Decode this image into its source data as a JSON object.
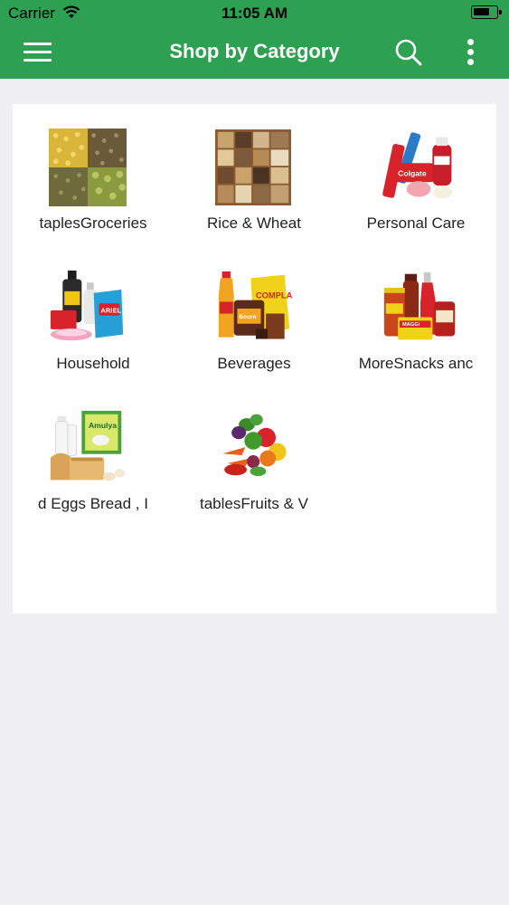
{
  "status_bar": {
    "carrier": "Carrier",
    "time": "11:05 AM"
  },
  "nav_bar": {
    "title": "Shop by Category",
    "menu_icon": "hamburger-menu-icon",
    "search_icon": "search-icon",
    "more_icon": "more-vertical-icon",
    "color": "#2ea052"
  },
  "categories": [
    {
      "label": "taplesGroceries",
      "icon": "grains-icon"
    },
    {
      "label": "Rice & Wheat",
      "icon": "spice-box-icon"
    },
    {
      "label": "Personal Care",
      "icon": "toiletries-icon"
    },
    {
      "label": "Household",
      "icon": "cleaning-products-icon"
    },
    {
      "label": "Beverages",
      "icon": "drinks-icon"
    },
    {
      "label": "MoreSnacks anc",
      "icon": "sauces-jars-icon"
    },
    {
      "label": "d Eggs Bread , I",
      "icon": "dairy-bread-icon"
    },
    {
      "label": "tablesFruits & V",
      "icon": "fruits-vegetables-icon"
    }
  ]
}
